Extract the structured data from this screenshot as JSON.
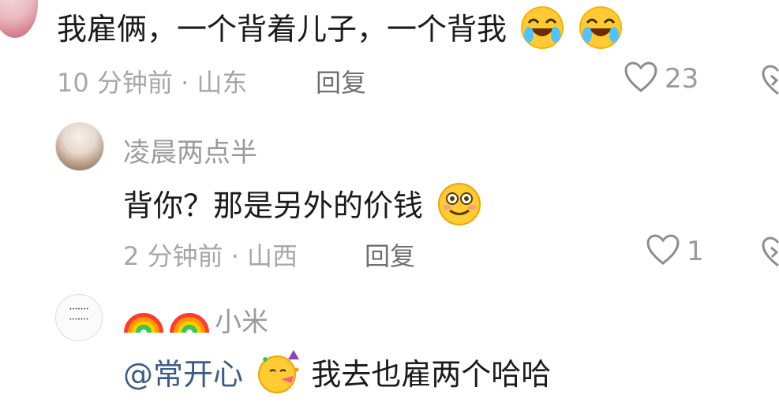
{
  "comments": [
    {
      "content": "我雇俩，一个背着儿子，一个背我",
      "emoji_1": "laugh-tears-emoji",
      "emoji_2": "laugh-tears-emoji",
      "time": "10 分钟前 · 山东",
      "reply_label": "回复",
      "likes": "23"
    },
    {
      "username": "凌晨两点半",
      "content": "背你？那是另外的价钱",
      "emoji": "smiling-emoji",
      "time": "2 分钟前 · 山西",
      "reply_label": "回复",
      "likes": "1"
    },
    {
      "username_prefix": "rainbow-emoji rainbow-emoji",
      "username": "小米",
      "mention": "@常开心",
      "mention_emoji": "party-face-emoji",
      "content": " 我去也雇两个哈哈"
    }
  ],
  "colors": {
    "text_primary": "#1b1b1b",
    "text_secondary": "#9b9b9b",
    "mention_blue": "#3d5d86",
    "heart_gray": "#8d8d8d"
  }
}
